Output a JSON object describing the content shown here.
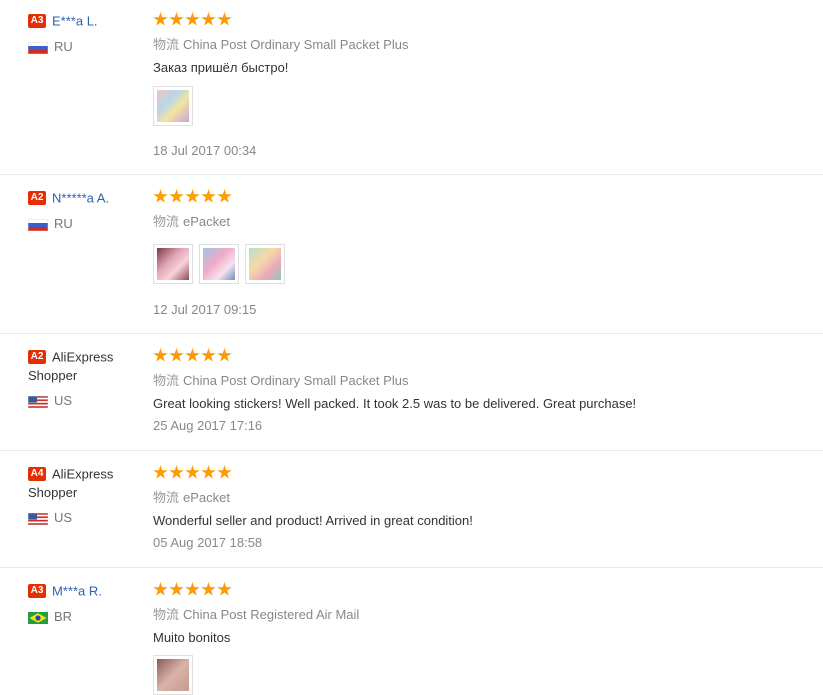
{
  "colors": {
    "badge": "#e62e04",
    "star": "#ff9a00",
    "link": "#2a61b5"
  },
  "shipping_label": "物流",
  "reviews": [
    {
      "level": "A3",
      "name": "E***a L.",
      "country": "RU",
      "flag": "ru-flag-icon",
      "rating": 5,
      "shipping": "China Post Ordinary Small Packet Plus",
      "text": "Заказ пришёл быстро!",
      "date": "18 Jul 2017 00:34",
      "photos": 1
    },
    {
      "level": "A2",
      "name": "N*****a A.",
      "country": "RU",
      "flag": "ru-flag-icon",
      "rating": 5,
      "shipping": "ePacket",
      "text": "",
      "date": "12 Jul 2017 09:15",
      "photos": 3
    },
    {
      "level": "A2",
      "name_line1": "AliExpress",
      "name_line2": "Shopper",
      "country": "US",
      "flag": "us-flag-icon",
      "rating": 5,
      "shipping": "China Post Ordinary Small Packet Plus",
      "text": "Great looking stickers! Well packed. It took 2.5 was to be delivered. Great purchase!",
      "date": "25 Aug 2017 17:16",
      "photos": 0
    },
    {
      "level": "A4",
      "name_line1": "AliExpress",
      "name_line2": "Shopper",
      "country": "US",
      "flag": "us-flag-icon",
      "rating": 5,
      "shipping": "ePacket",
      "text": "Wonderful seller and product! Arrived in great condition!",
      "date": "05 Aug 2017 18:58",
      "photos": 0
    },
    {
      "level": "A3",
      "name": "M***a R.",
      "country": "BR",
      "flag": "br-flag-icon",
      "rating": 5,
      "shipping": "China Post Registered Air Mail",
      "text": "Muito bonitos",
      "date": "",
      "photos": 1
    }
  ]
}
